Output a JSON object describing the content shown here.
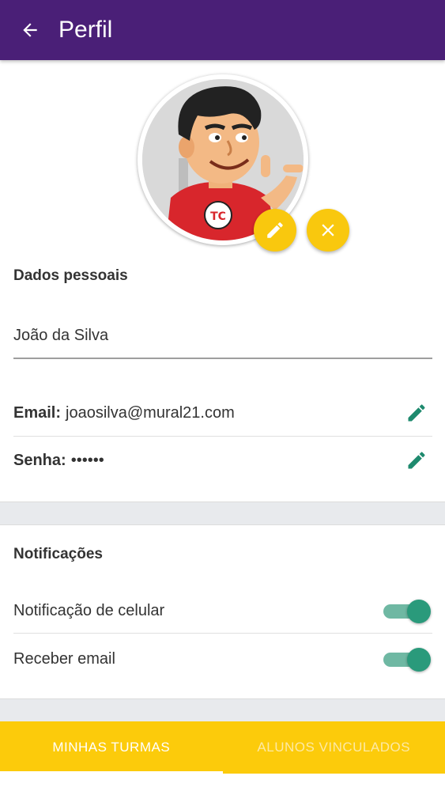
{
  "appbar": {
    "title": "Perfil",
    "back_icon": "arrow-left-icon",
    "color": "#4a1f77"
  },
  "avatar": {
    "edit_icon": "pencil-icon",
    "remove_icon": "close-icon",
    "accent": "#f9c80e",
    "badge_text": "TC"
  },
  "personal": {
    "title": "Dados pessoais",
    "name_value": "João da Silva",
    "email_label": "Email:",
    "email_value": "joaosilva@mural21.com",
    "password_label": "Senha:",
    "password_value": "••••••",
    "edit_icon": "pencil-icon",
    "icon_color": "#1e8a6e"
  },
  "notifications": {
    "title": "Notificações",
    "items": [
      {
        "label": "Notificação de celular",
        "enabled": true
      },
      {
        "label": "Receber email",
        "enabled": true
      }
    ]
  },
  "bottom_nav": {
    "tabs": [
      {
        "label": "MINHAS TURMAS",
        "active": true
      },
      {
        "label": "ALUNOS VINCULADOS",
        "active": false
      }
    ],
    "color": "#fccb0b"
  }
}
